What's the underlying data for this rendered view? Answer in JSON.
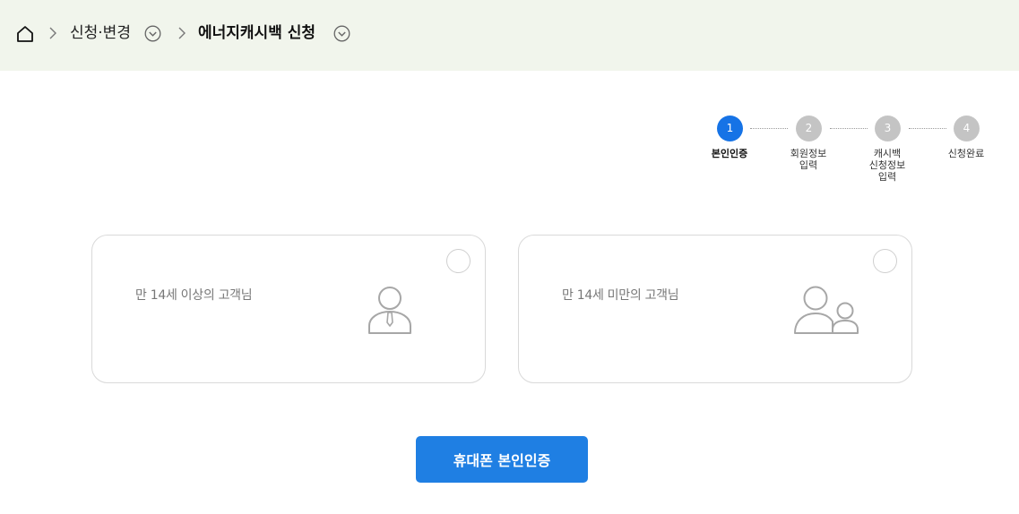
{
  "breadcrumb": {
    "home_icon": "home-icon",
    "parent_label": "신청·변경",
    "current_label": "에너지캐시백 신청"
  },
  "steps": [
    {
      "number": "1",
      "label_lines": [
        "본인인증"
      ],
      "active": true
    },
    {
      "number": "2",
      "label_lines": [
        "회원정보",
        "입력"
      ],
      "active": false
    },
    {
      "number": "3",
      "label_lines": [
        "캐시백",
        "신청정보",
        "입력"
      ],
      "active": false
    },
    {
      "number": "4",
      "label_lines": [
        "신청완료"
      ],
      "active": false
    }
  ],
  "cards": [
    {
      "title": "만 14세 이상의 고객님",
      "icon": "adult-person-icon",
      "selected": false
    },
    {
      "title": "만 14세 미만의 고객님",
      "icon": "parent-child-icon",
      "selected": false
    }
  ],
  "action_button": {
    "label": "휴대폰 본인인증"
  },
  "colors": {
    "header_bg": "#f1f5ec",
    "active_step": "#1673e6",
    "inactive_step": "#c4c4c4",
    "button": "#1f7fe3"
  }
}
